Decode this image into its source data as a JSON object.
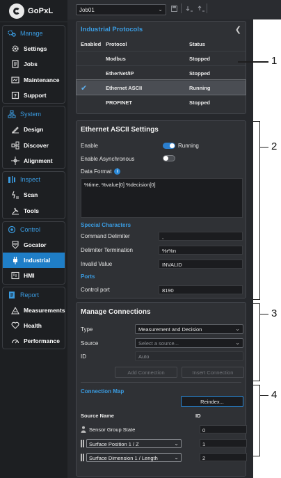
{
  "app": {
    "brand": "GoPxL"
  },
  "topbar": {
    "job": "Job01"
  },
  "sidebar": {
    "sections": [
      {
        "label": "Manage",
        "icon": "gears-icon",
        "items": [
          {
            "label": "Settings",
            "icon": "gear-icon"
          },
          {
            "label": "Jobs",
            "icon": "jobs-icon"
          },
          {
            "label": "Maintenance",
            "icon": "wrench-icon"
          },
          {
            "label": "Support",
            "icon": "support-icon"
          }
        ]
      },
      {
        "label": "System",
        "icon": "network-icon",
        "items": [
          {
            "label": "Design",
            "icon": "design-icon"
          },
          {
            "label": "Discover",
            "icon": "discover-icon"
          },
          {
            "label": "Alignment",
            "icon": "crosshair-icon"
          }
        ]
      },
      {
        "label": "Inspect",
        "icon": "inspect-icon",
        "items": [
          {
            "label": "Scan",
            "icon": "scan-icon"
          },
          {
            "label": "Tools",
            "icon": "tools-icon"
          }
        ]
      },
      {
        "label": "Control",
        "icon": "power-icon",
        "items": [
          {
            "label": "Gocator",
            "icon": "gocator-icon"
          },
          {
            "label": "Industrial",
            "icon": "plug-icon",
            "active": true
          },
          {
            "label": "HMI",
            "icon": "hmi-icon"
          }
        ]
      },
      {
        "label": "Report",
        "icon": "report-icon",
        "items": [
          {
            "label": "Measurements",
            "icon": "measurements-icon"
          },
          {
            "label": "Health",
            "icon": "heart-icon"
          },
          {
            "label": "Performance",
            "icon": "gauge-icon"
          }
        ]
      }
    ]
  },
  "protocols": {
    "title": "Industrial Protocols",
    "columns": {
      "enabled": "Enabled",
      "protocol": "Protocol",
      "status": "Status"
    },
    "rows": [
      {
        "name": "Modbus",
        "status": "Stopped",
        "enabled": false
      },
      {
        "name": "EtherNet/IP",
        "status": "Stopped",
        "enabled": false
      },
      {
        "name": "Ethernet ASCII",
        "status": "Running",
        "enabled": true,
        "check": "✔"
      },
      {
        "name": "PROFINET",
        "status": "Stopped",
        "enabled": false
      }
    ]
  },
  "ascii": {
    "title": "Ethernet ASCII Settings",
    "enable_label": "Enable",
    "enable_state": "Running",
    "async_label": "Enable Asynchronous",
    "format_label": "Data Format",
    "format_value": "%time, %value[0] %decision[0]",
    "special_head": "Special Characters",
    "cmd_delim_label": "Command Delimiter",
    "cmd_delim_value": ",",
    "delim_term_label": "Delimiter Termination",
    "delim_term_value": "%r%n",
    "invalid_label": "Invalid Value",
    "invalid_value": "INVALID",
    "ports_head": "Ports",
    "control_port_label": "Control port",
    "control_port_value": "8190"
  },
  "connections": {
    "title": "Manage Connections",
    "type_label": "Type",
    "type_value": "Measurement and Decision",
    "source_label": "Source",
    "source_placeholder": "Select a source...",
    "id_label": "ID",
    "id_placeholder": "Auto",
    "add_button": "Add Connection",
    "insert_button": "Insert Connection",
    "map_head": "Connection Map",
    "reindex_button": "Reindex...",
    "col_source": "Source Name",
    "col_id": "ID",
    "map_rows": [
      {
        "name": "Sensor Group State",
        "id": "0",
        "fixed": true
      },
      {
        "name": "Surface Position 1 / Z",
        "id": "1"
      },
      {
        "name": "Surface Dimension 1 / Length",
        "id": "2"
      }
    ]
  },
  "callouts": [
    "1",
    "2",
    "3",
    "4"
  ]
}
